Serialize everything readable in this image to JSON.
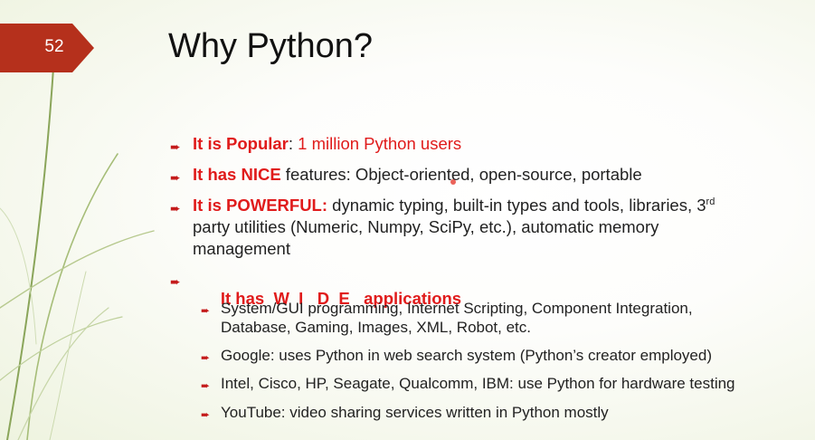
{
  "slide": {
    "number": "52",
    "title": "Why Python?"
  },
  "bullets": [
    {
      "lead": "It is Popular",
      "sep": ":",
      "rest": " 1 million Python users"
    },
    {
      "lead": "It has NICE",
      "rest": " features: Object-oriented, open-source, portable"
    },
    {
      "lead": "It is POWERFUL:",
      "rest": " dynamic typing, built-in types and tools, libraries, 3",
      "sup": "rd",
      "line2": "party utilities (Numeric, Numpy, SciPy, etc.), automatic memory",
      "line3": "management"
    },
    {
      "lead": "It has  W  I   D  E   applications"
    }
  ],
  "subbullets": [
    {
      "line1": "System/GUI programming, Internet Scripting, Component Integration,",
      "line2": "Database, Gaming, Images, XML, Robot, etc."
    },
    {
      "line1": "Google: uses Python in web search system (Python’s creator employed)"
    },
    {
      "line1": "Intel, Cisco, HP, Seagate, Qualcomm, IBM: use Python for hardware testing"
    },
    {
      "line1": "YouTube: video sharing services written in Python mostly"
    }
  ],
  "colors": {
    "accent_red": "#e01b1b",
    "tab_red": "#b5301c",
    "stalk_green": "#9cb56a"
  },
  "icons": {
    "bullet": "arrow-right-icon"
  }
}
